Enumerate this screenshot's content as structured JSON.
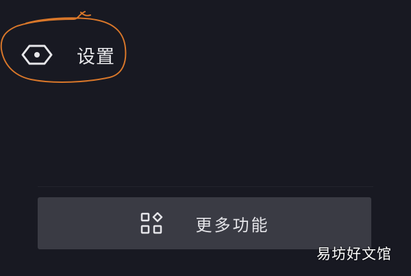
{
  "settings": {
    "label": "设置",
    "icon": "hexagon-settings-icon"
  },
  "more_features": {
    "label": "更多功能",
    "icon": "apps-grid-icon"
  },
  "watermark": {
    "text": "易坊好文馆"
  },
  "colors": {
    "background": "#181922",
    "button_background": "#3a3b44",
    "text": "#e7e7ea",
    "annotation": "#d9772a"
  }
}
